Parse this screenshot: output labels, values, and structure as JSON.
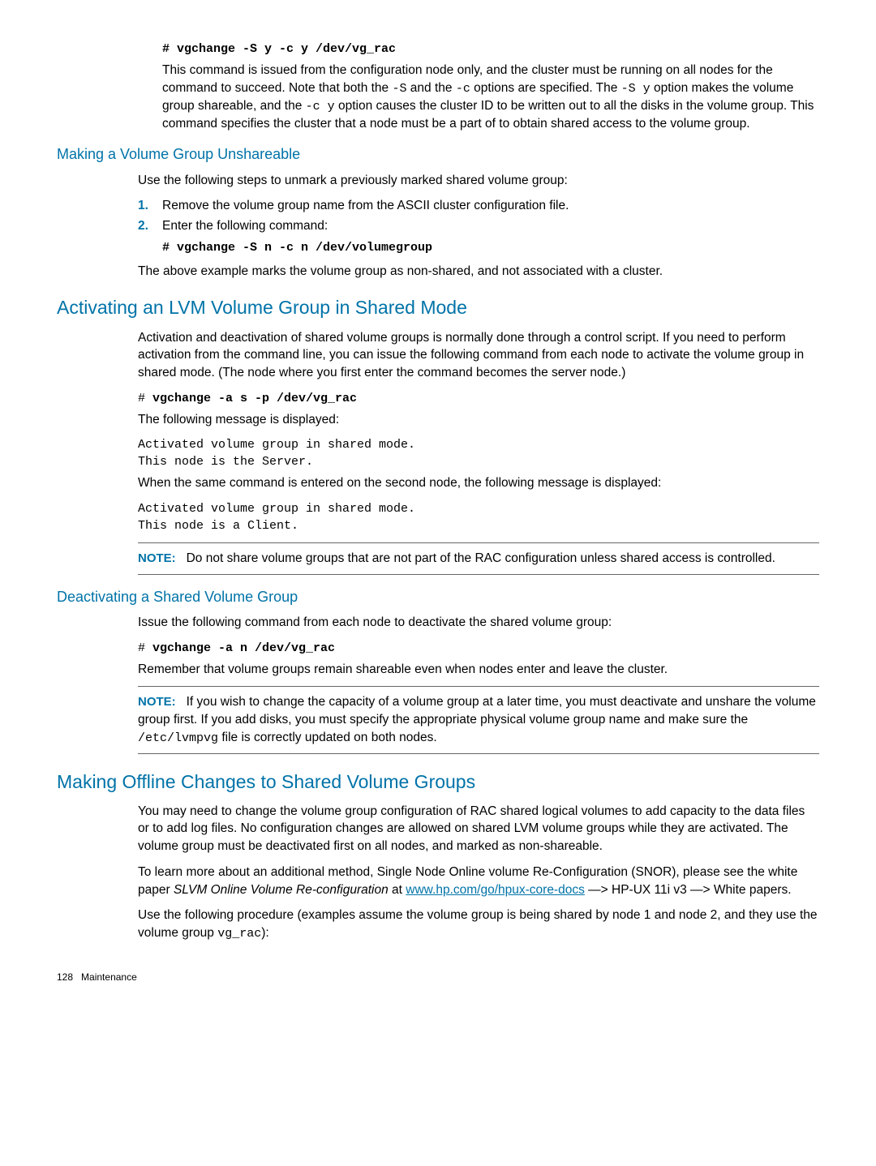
{
  "intro": {
    "cmd": "# vgchange -S y -c y /dev/vg_rac",
    "para": "This command is issued from the configuration node only, and the cluster must be running on all nodes for the command to succeed. Note that both the ",
    "c1": "-S",
    "para2": " and the ",
    "c2": "-c",
    "para3": " options are specified. The ",
    "c3": "-S y",
    "para4": " option makes the volume group shareable, and the ",
    "c4": "-c y",
    "para5": " option causes the cluster ID to be written out to all the disks in the volume group. This command specifies the cluster that a node must be a part of to obtain shared access to the volume group."
  },
  "unshare": {
    "title": "Making a Volume Group Unshareable",
    "p1": "Use the following steps to unmark a previously marked shared volume group:",
    "li1": "Remove the volume group name from the ASCII cluster configuration file.",
    "li2": "Enter the following command:",
    "cmd": "# vgchange -S n -c n /dev/volumegroup",
    "p2": "The above example marks the volume group as non-shared, and not associated with a cluster."
  },
  "activating": {
    "title": "Activating an LVM Volume Group in Shared Mode",
    "p1": "Activation and deactivation of shared volume groups is normally done through a control script. If you need to perform activation from the command line, you can issue the following command from each node to activate the volume group in shared mode. (The node where you first enter the command becomes the server node.)",
    "cmd1_prefix": "# ",
    "cmd1": "vgchange -a s -p /dev/vg_rac",
    "p2": "The following message is displayed:",
    "out1a": "Activated volume group in shared mode.",
    "out1b": "This node is the Server.",
    "p3": "When the same command is entered on the second node, the following message is displayed:",
    "out2a": "Activated volume group in shared mode.",
    "out2b": "This node is a Client.",
    "note_label": "NOTE:",
    "note": "Do not share volume groups that are not part of the RAC configuration unless shared access is controlled."
  },
  "deact": {
    "title": "Deactivating a Shared Volume Group",
    "p1": "Issue the following command from each node to deactivate the shared volume group:",
    "cmd_prefix": "# ",
    "cmd": "vgchange -a n /dev/vg_rac",
    "p2": "Remember that volume groups remain shareable even when nodes enter and leave the cluster.",
    "note_label": "NOTE:",
    "note_a": "If you wish to change the capacity of a volume group at a later time, you must deactivate and unshare the volume group first. If you add disks, you must specify the appropriate physical volume group name and make sure the ",
    "note_code": "/etc/lvmpvg",
    "note_b": " file is correctly updated on both nodes."
  },
  "offline": {
    "title": "Making Offline Changes to Shared Volume Groups",
    "p1": "You may need to change the volume group configuration of RAC shared logical volumes to add capacity to the data files or to add log files. No configuration changes are allowed on shared LVM volume groups while they are activated. The volume group must be deactivated first on all nodes, and marked as non-shareable.",
    "p2a": "To learn more about an additional method, Single Node Online volume Re-Configuration (SNOR), please see the white paper ",
    "p2_italic": "SLVM Online Volume Re-configuration",
    "p2b": " at ",
    "link": "www.hp.com/go/hpux-core-docs",
    "p2c": " —> HP-UX 11i v3 —> White papers.",
    "p3a": "Use the following procedure (examples assume the volume group is being shared by node 1 and node 2, and they use the volume group ",
    "p3_code": "vg_rac",
    "p3b": "):"
  },
  "footer": {
    "page": "128",
    "section": "Maintenance"
  },
  "ol": {
    "n1": "1.",
    "n2": "2."
  }
}
